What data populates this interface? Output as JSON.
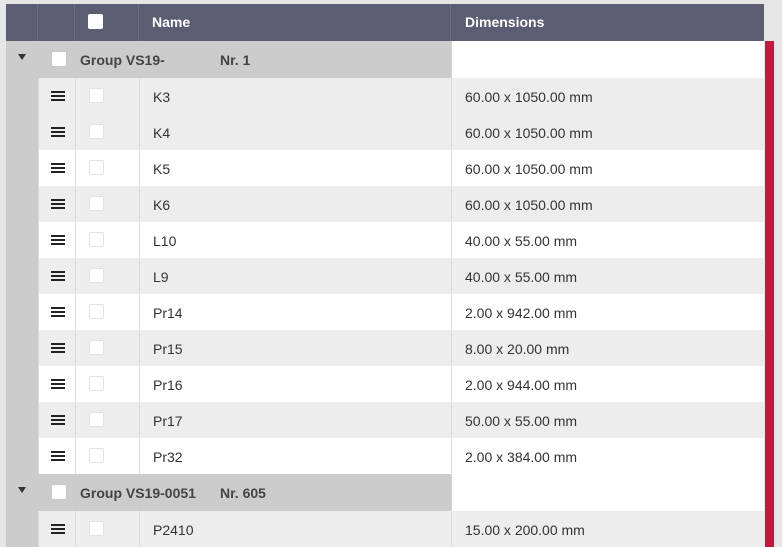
{
  "header": {
    "name_label": "Name",
    "dimensions_label": "Dimensions"
  },
  "groups": [
    {
      "title": "Group VS19-",
      "nr": "Nr. 1",
      "rows": [
        {
          "name": "K3",
          "dimensions": "60.00 x 1050.00 mm"
        },
        {
          "name": "K4",
          "dimensions": "60.00 x 1050.00 mm"
        },
        {
          "name": "K5",
          "dimensions": "60.00 x 1050.00 mm"
        },
        {
          "name": "K6",
          "dimensions": "60.00 x 1050.00 mm"
        },
        {
          "name": "L10",
          "dimensions": "40.00 x 55.00 mm"
        },
        {
          "name": "L9",
          "dimensions": "40.00 x 55.00 mm"
        },
        {
          "name": "Pr14",
          "dimensions": "2.00 x 942.00 mm"
        },
        {
          "name": "Pr15",
          "dimensions": "8.00 x 20.00 mm"
        },
        {
          "name": "Pr16",
          "dimensions": "2.00 x 944.00 mm"
        },
        {
          "name": "Pr17",
          "dimensions": "50.00 x 55.00 mm"
        },
        {
          "name": "Pr32",
          "dimensions": "2.00 x 384.00 mm"
        }
      ]
    },
    {
      "title": "Group VS19-0051",
      "nr": "Nr. 605",
      "rows": [
        {
          "name": "P2410",
          "dimensions": "15.00 x 200.00 mm"
        }
      ]
    }
  ],
  "colors": {
    "header_bg": "#5b5e73",
    "group_bg": "#cccccc",
    "row_alt_bg": "#ededed",
    "accent": "#c8173c"
  }
}
